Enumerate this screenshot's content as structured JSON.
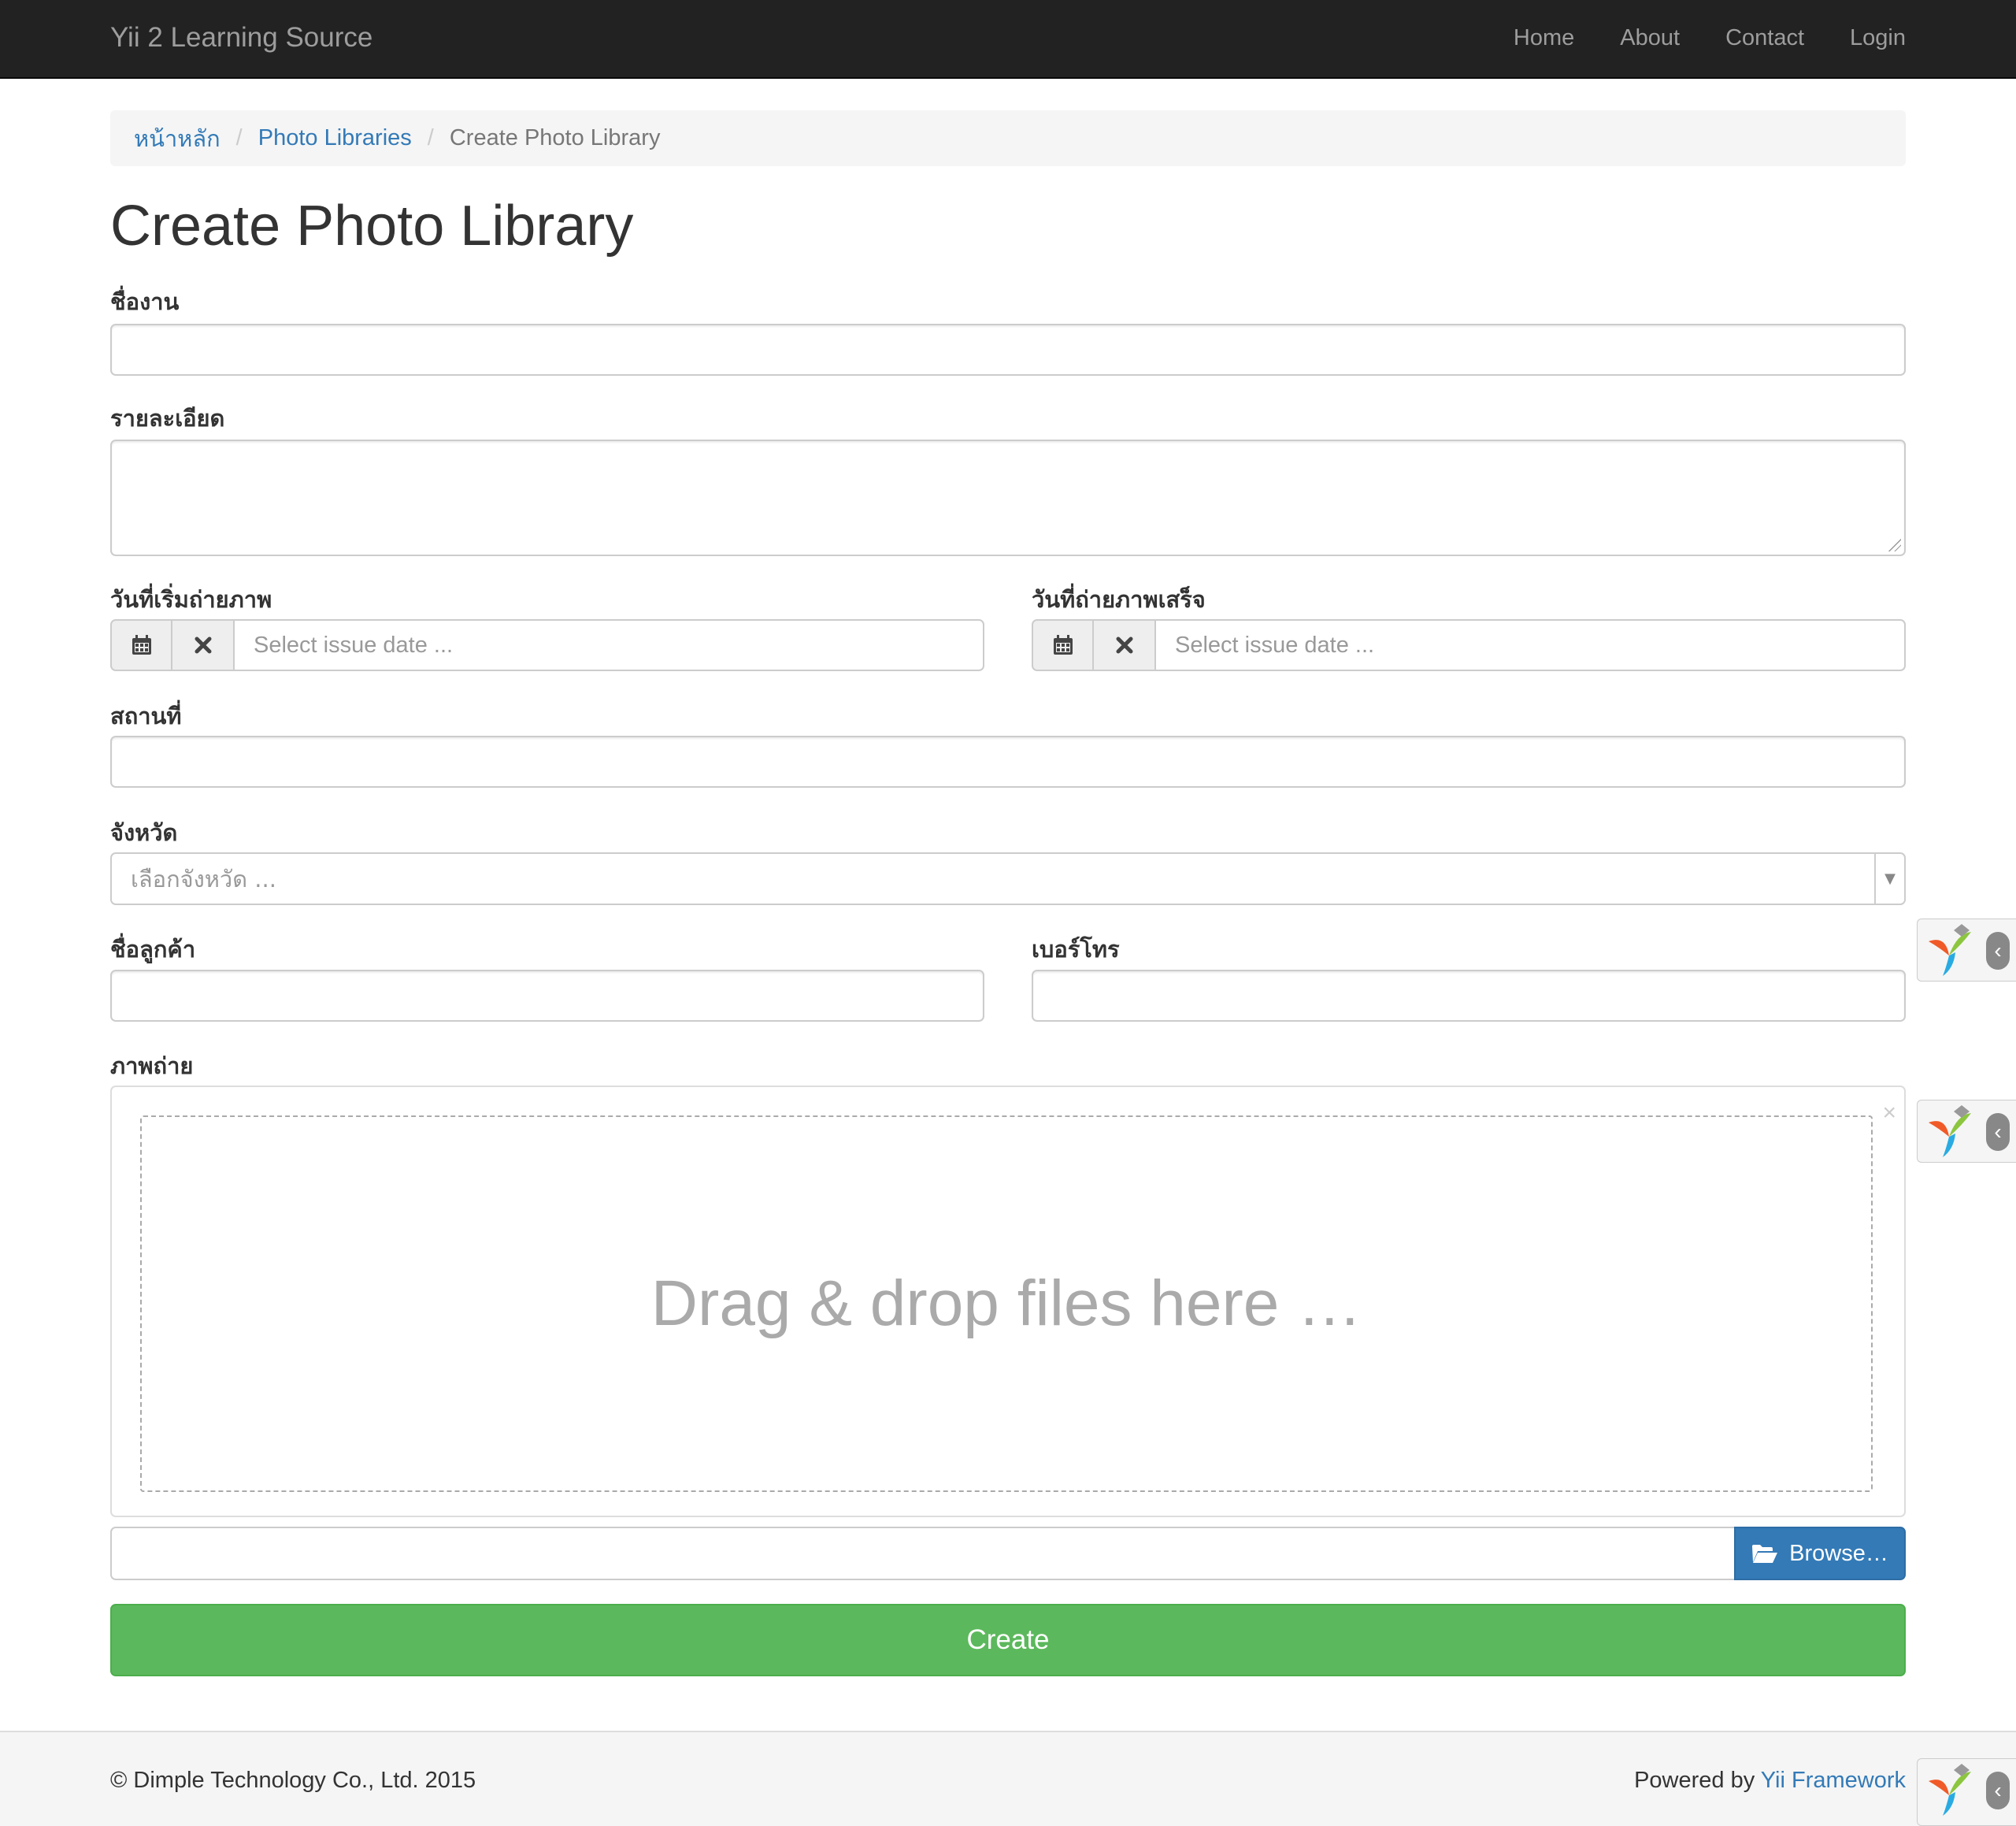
{
  "navbar": {
    "brand": "Yii 2 Learning Source",
    "links": [
      "Home",
      "About",
      "Contact",
      "Login"
    ]
  },
  "breadcrumb": {
    "home": "หน้าหลัก",
    "parent": "Photo Libraries",
    "current": "Create Photo Library",
    "separator": "/"
  },
  "page": {
    "title": "Create Photo Library"
  },
  "form": {
    "job_name": {
      "label": "ชื่องาน",
      "value": ""
    },
    "details": {
      "label": "รายละเอียด",
      "value": ""
    },
    "start_date": {
      "label": "วันที่เริ่มถ่ายภาพ",
      "placeholder": "Select issue date ..."
    },
    "end_date": {
      "label": "วันที่ถ่ายภาพเสร็จ",
      "placeholder": "Select issue date ..."
    },
    "location": {
      "label": "สถานที่",
      "value": ""
    },
    "province": {
      "label": "จังหวัด",
      "placeholder": "เลือกจังหวัด ..."
    },
    "customer_name": {
      "label": "ชื่อลูกค้า",
      "value": ""
    },
    "phone": {
      "label": "เบอร์โทร",
      "value": ""
    },
    "photos": {
      "label": "ภาพถ่าย",
      "dropzone_text": "Drag & drop files here …",
      "close_glyph": "×",
      "browse_label": "Browse…"
    },
    "submit_label": "Create"
  },
  "icons": {
    "calendar": "calendar-icon",
    "clear": "times-icon",
    "folder": "folder-open-icon",
    "debug": "yii-debug-icon"
  },
  "colors": {
    "navbar_bg": "#222222",
    "link": "#337ab7",
    "primary": "#337ab7",
    "success": "#5cb85c",
    "footer_bg": "#f5f5f5"
  },
  "footer": {
    "copyright": "© Dimple Technology Co., Ltd. 2015",
    "powered_prefix": "Powered by ",
    "powered_link": "Yii Framework"
  }
}
